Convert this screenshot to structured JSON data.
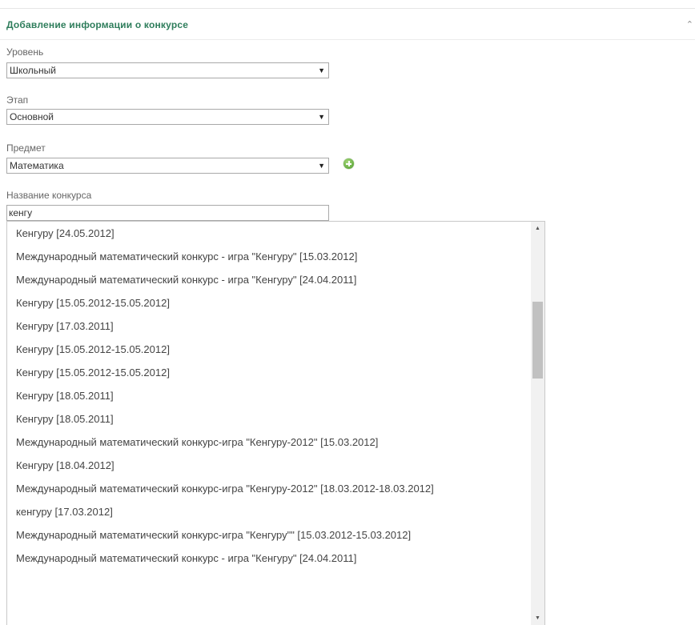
{
  "panel": {
    "title": "Добавление информации о конкурсе"
  },
  "level": {
    "label": "Уровень",
    "value": "Школьный"
  },
  "stage": {
    "label": "Этап",
    "value": "Основной"
  },
  "subject": {
    "label": "Предмет",
    "value": "Математика"
  },
  "contest_name": {
    "label": "Название конкурса",
    "value": "кенгу"
  },
  "suggestions": [
    "Кенгуру [24.05.2012]",
    "Международный математический конкурс - игра \"Кенгуру\" [15.03.2012]",
    "Международный математический конкурс - игра \"Кенгуру\" [24.04.2011]",
    "Кенгуру [15.05.2012-15.05.2012]",
    "Кенгуру [17.03.2011]",
    "Кенгуру [15.05.2012-15.05.2012]",
    "Кенгуру [15.05.2012-15.05.2012]",
    "Кенгуру [18.05.2011]",
    "Кенгуру [18.05.2011]",
    "Международный математический конкурс-игра \"Кенгуру-2012\" [15.03.2012]",
    "Кенгуру [18.04.2012]",
    "Международный математический конкурс-игра \"Кенгуру-2012\" [18.03.2012-18.03.2012]",
    "кенгуру [17.03.2012]",
    "Международный математический конкурс-игра \"Кенгуру\"\" [15.03.2012-15.03.2012]",
    "Международный математический конкурс - игра \"Кенгуру\" [24.04.2011]"
  ],
  "icons": {
    "dropdown_arrow": "triangle-down-icon",
    "add": "green-plus-circle-icon",
    "collapse": "caret-icon"
  },
  "colors": {
    "title": "#2e7d5b",
    "add_icon": "#4c9a2a"
  }
}
